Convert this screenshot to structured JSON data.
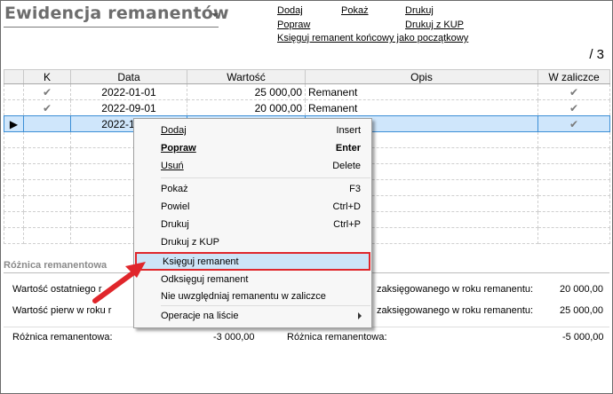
{
  "title": "Ewidencja remanentów",
  "links": {
    "dodaj": "Dodaj",
    "pokaz": "Pokaż",
    "drukuj": "Drukuj",
    "popraw": "Popraw",
    "drukuj_kup": "Drukuj z KUP",
    "ksieguj_koncowy": "Księguj remanent końcowy jako początkowy"
  },
  "page_count": "/ 3",
  "grid": {
    "headers": [
      "K",
      "Data",
      "Wartość",
      "Opis",
      "W zaliczce"
    ],
    "rows": [
      {
        "k": "✔",
        "data": "2022-01-01",
        "wartosc": "25 000,00",
        "opis": "Remanent",
        "w_zaliczce": "✔"
      },
      {
        "k": "✔",
        "data": "2022-09-01",
        "wartosc": "20 000,00",
        "opis": "Remanent",
        "w_zaliczce": "✔"
      },
      {
        "k": "",
        "data": "2022-10-31",
        "wartosc": "",
        "opis": "",
        "w_zaliczce": "✔"
      }
    ]
  },
  "summary": {
    "section_label": "Różnica remanentowa",
    "row1_left": "Wartość ostatniego",
    "row1_left_cut": "r",
    "row1_right": "zaksięgowanego w roku remanentu:",
    "row1_value": "20 000,00",
    "row2_left": "Wartość pierw",
    "row2_left_b": "w roku r",
    "row2_right": "zaksięgowanego w roku remanentu:",
    "row2_value": "25 000,00",
    "diff_label_left": "Różnica remanentowa:",
    "diff_value_left": "-3 000,00",
    "diff_label_right": "Różnica remanentowa:",
    "diff_value_right": "-5 000,00"
  },
  "context_menu": {
    "items": [
      {
        "label": "Dodaj",
        "shortcut": "Insert"
      },
      {
        "label": "Popraw",
        "shortcut": "Enter"
      },
      {
        "label": "Usuń",
        "shortcut": "Delete"
      },
      {
        "label": "Pokaż",
        "shortcut": "F3"
      },
      {
        "label": "Powiel",
        "shortcut": "Ctrl+D"
      },
      {
        "label": "Drukuj",
        "shortcut": "Ctrl+P"
      },
      {
        "label": "Drukuj z KUP",
        "shortcut": ""
      },
      {
        "label": "Księguj remanent",
        "shortcut": ""
      },
      {
        "label": "Odksięguj remanent",
        "shortcut": ""
      },
      {
        "label": "Nie uwzględniaj remanentu w zaliczce",
        "shortcut": ""
      },
      {
        "label": "Operacje na liście",
        "shortcut": ""
      }
    ]
  },
  "colors": {
    "highlight_border": "#e0262b",
    "arrow": "#e0262b",
    "selection": "#cfe6fb"
  }
}
